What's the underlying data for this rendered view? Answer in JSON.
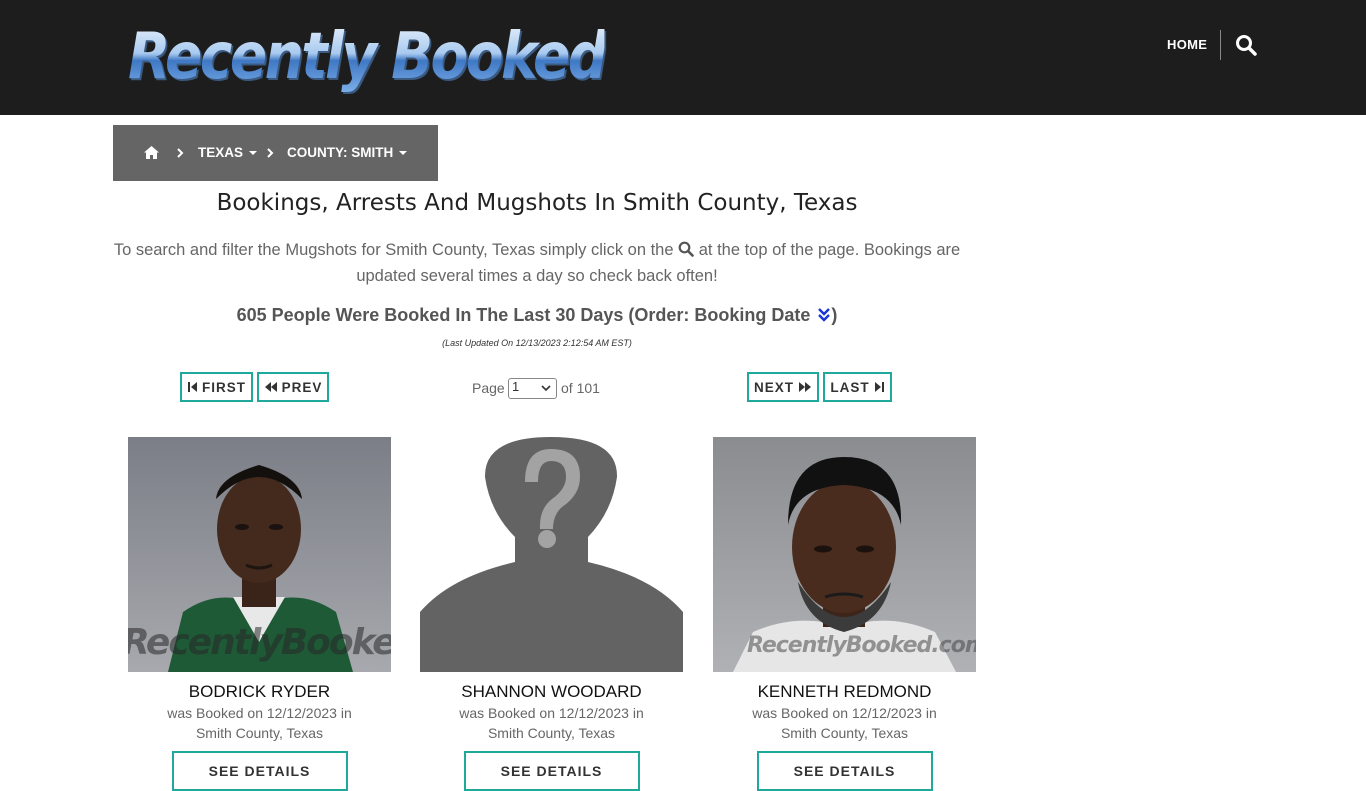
{
  "header": {
    "logo_text": "Recently Booked",
    "nav": {
      "home_label": "HOME"
    }
  },
  "breadcrumb": {
    "state": "TEXAS",
    "county": "COUNTY: SMITH"
  },
  "main": {
    "title": "Bookings, Arrests And Mugshots In Smith County, Texas",
    "intro_before": "To search and filter the Mugshots for Smith County, Texas simply click on the",
    "intro_after": "at the top of the page. Bookings are updated several times a day so check back often!",
    "count_text": "605 People Were Booked In The Last 30 Days (Order: Booking Date",
    "count_close": ")",
    "last_updated": "(Last Updated On 12/13/2023 2:12:54 AM EST)"
  },
  "pagination": {
    "first_label": "FIRST",
    "prev_label": "PREV",
    "next_label": "NEXT",
    "last_label": "LAST",
    "page_label": "Page",
    "current_page": "1",
    "of_label": "of 101"
  },
  "accent_color": "#1fa99d",
  "cards": [
    {
      "name": "BODRICK RYDER",
      "booked_line1": "was Booked on 12/12/2023 in",
      "booked_line2": "Smith County, Texas",
      "details_label": "SEE DETAILS",
      "photo_watermark": "RecentlyBooked.com"
    },
    {
      "name": "SHANNON WOODARD",
      "booked_line1": "was Booked on 12/12/2023 in",
      "booked_line2": "Smith County, Texas",
      "details_label": "SEE DETAILS",
      "photo_watermark": ""
    },
    {
      "name": "KENNETH REDMOND",
      "booked_line1": "was Booked on 12/12/2023 in",
      "booked_line2": "Smith County, Texas",
      "details_label": "SEE DETAILS",
      "photo_watermark": "RecentlyBooked.com"
    }
  ]
}
